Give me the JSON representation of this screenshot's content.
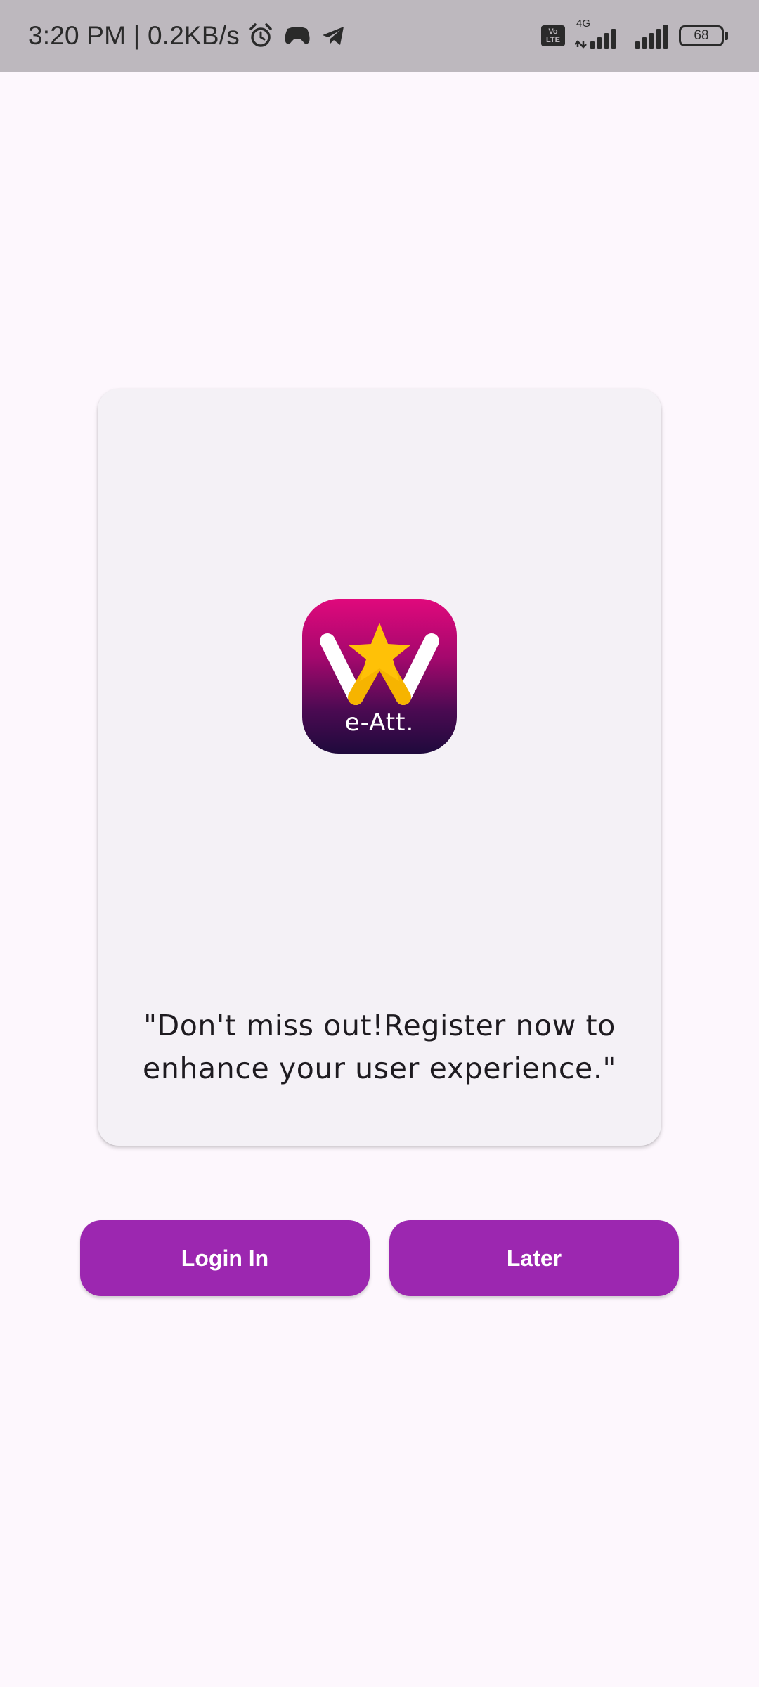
{
  "status_bar": {
    "time_speed": "3:20 PM | 0.2KB/s",
    "icons": [
      "alarm-icon",
      "gamepad-icon",
      "telegram-icon"
    ],
    "volte": "Vo LTE",
    "network_type": "4G",
    "battery_level": "68"
  },
  "card": {
    "logo": {
      "icon": "e-att-logo",
      "text": "e-Att."
    },
    "message": "\"Don't miss out!Register now to enhance your user experience.\""
  },
  "buttons": {
    "login_label": "Login In",
    "later_label": "Later"
  },
  "colors": {
    "background": "#fdf7fd",
    "status_bar": "#bdb8be",
    "card": "#f4f1f6",
    "button": "#9c27b0",
    "button_text": "#ffffff"
  }
}
